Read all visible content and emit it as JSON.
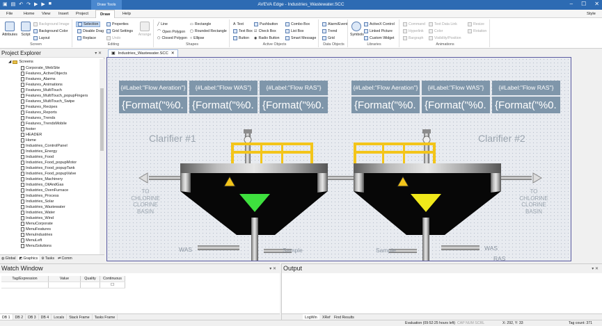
{
  "title_bar": {
    "title": "AVEVA Edge - Industries_Wastewater.SCC",
    "context_tab": "Draw Tools"
  },
  "menu": {
    "tabs": [
      "File",
      "Home",
      "View",
      "Insert",
      "Project",
      "Draw",
      "Help"
    ],
    "style": "Style"
  },
  "ribbon": {
    "screen": {
      "label": "Screen",
      "attributes": "Attributes",
      "script": "Script",
      "background_image": "Background Image",
      "background_color": "Background Color",
      "layout": "Layout"
    },
    "editing": {
      "label": "Editing",
      "selection": "Selection",
      "disable_drag": "Disable Drag",
      "replace": "Replace",
      "properties": "Properties",
      "grid_settings": "Grid Settings",
      "undo": "Undo",
      "arrange": "Arrange"
    },
    "shapes": {
      "label": "Shapes",
      "line": "Line",
      "open_polygon": "Open Polygon",
      "closed_polygon": "Closed Polygon",
      "rectangle": "Rectangle",
      "rounded_rectangle": "Rounded Rectangle",
      "ellipse": "Ellipse"
    },
    "active_objects": {
      "label": "Active Objects",
      "text": "Text",
      "text_box": "Text Box",
      "button": "Button",
      "pushbutton": "Pushbutton",
      "check_box": "Check Box",
      "radio_button": "Radio Button",
      "combo_box": "Combo Box",
      "list_box": "List Box",
      "smart_message": "Smart Message"
    },
    "data_objects": {
      "label": "Data Objects",
      "alarm_event": "Alarm/Event",
      "trend": "Trend",
      "grid": "Grid"
    },
    "libraries": {
      "label": "Libraries",
      "symbols": "Symbols",
      "activex_control": "ActiveX Control",
      "linked_picture": "Linked Picture",
      "custom_widget": "Custom Widget"
    },
    "animations": {
      "label": "Animations",
      "command": "Command",
      "hyperlink": "Hyperlink",
      "bargraph": "Bargraph",
      "text_data_link": "Text Data Link",
      "color": "Color",
      "visibility_position": "Visibility/Position",
      "resize": "Resize",
      "rotation": "Rotation"
    }
  },
  "explorer": {
    "title": "Project Explorer",
    "root": "Screens",
    "items": [
      "Corporate_WebSite",
      "Features_ActiveObjects",
      "Features_Alarms",
      "Features_Animations",
      "Features_MultiTouch",
      "Features_MultiTouch_popupFingers",
      "Features_MultiTouch_Swipe",
      "Features_Recipes",
      "Features_Reports",
      "Features_Trends",
      "Features_TrendsMobile",
      "footer",
      "HEADER",
      "Home",
      "Industries_ControlPanel",
      "Industries_Energy",
      "Industries_Food",
      "Industries_Food_popupMotor",
      "Industries_Food_popupTank",
      "Industries_Food_popupValve",
      "Industries_Machinery",
      "Industries_OilAndGas",
      "Industries_OvenFurnace",
      "Industries_Process",
      "Industries_Solar",
      "Industries_Wastewater",
      "Industries_Water",
      "Industries_Wind",
      "MenuCorporate",
      "MenuFeatures",
      "MenuIndustries",
      "MenuLeft",
      "MenuSolutions"
    ],
    "tabs": [
      "Global",
      "Graphics",
      "Tasks",
      "Comm"
    ]
  },
  "document": {
    "tab": "Industries_Wastewater.SCC",
    "labels": [
      "{#Label:\"Flow Aeration\"}",
      "{#Label:\"Flow WAS\"}",
      "{#Label:\"Flow RAS\"}"
    ],
    "format_text": "{Format(\"%0.",
    "clarifier1": "Clarifier #1",
    "clarifier2": "Clarifier #2",
    "basin": [
      "TO",
      "CHLORINE",
      "CLORINE",
      "BASIN"
    ],
    "was": "WAS",
    "ras": "RAS",
    "sample": "Sample",
    "colors": {
      "left_cone": "#3ee03e",
      "right_cone": "#f0e81a",
      "rail": "#f3c51a",
      "label_box": "#7f96aa"
    }
  },
  "watch": {
    "title": "Watch Window",
    "columns": [
      "Tag/Expression",
      "Value",
      "Quality",
      "Continuous"
    ],
    "tabs": [
      "DB 1",
      "DB 2",
      "DB 3",
      "DB 4",
      "Locals",
      "Stack Frame",
      "Tasks Frame"
    ]
  },
  "output": {
    "title": "Output",
    "tabs": [
      "LogWin",
      "XRef",
      "Find Results"
    ]
  },
  "status": {
    "evaluation": "Evaluation (09:52:25 hours left)",
    "cap": "CAP NUM SCRL",
    "coords": "X: 292, Y: 33",
    "tag_count": "Tag count: 371"
  }
}
